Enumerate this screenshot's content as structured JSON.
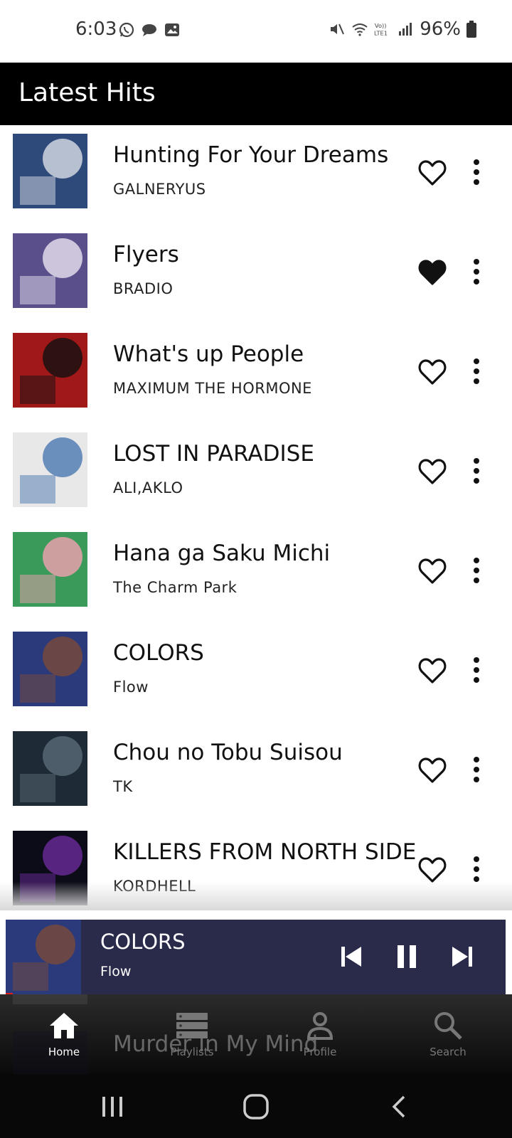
{
  "status_bar": {
    "time": "6:03",
    "left_icons": [
      "whatsapp-icon",
      "chat-bubble-icon",
      "gallery-icon"
    ],
    "right_icons": [
      "mute-icon",
      "wifi-icon",
      "volte-icon",
      "signal-icon"
    ],
    "volte_label": "VoLTE1",
    "battery": "96%"
  },
  "header": {
    "title": "Latest Hits"
  },
  "songs": [
    {
      "title": "Hunting For Your Dreams",
      "artist": "GALNERYUS",
      "liked": false,
      "cover_colors": [
        "#2e4a7a",
        "#d9dde6"
      ]
    },
    {
      "title": "Flyers",
      "artist": "BRADIO",
      "liked": true,
      "cover_colors": [
        "#5a4f8a",
        "#e8e2f0"
      ]
    },
    {
      "title": "What's up People",
      "artist": "MAXIMUM THE HORMONE",
      "liked": false,
      "cover_colors": [
        "#a01818",
        "#111111"
      ]
    },
    {
      "title": "LOST IN PARADISE",
      "artist": "ALI,AKLO",
      "liked": false,
      "cover_colors": [
        "#e8e8e8",
        "#4a78b0"
      ]
    },
    {
      "title": "Hana ga Saku Michi",
      "artist": "The Charm Park",
      "liked": false,
      "cover_colors": [
        "#3a9a5a",
        "#f2a0b0"
      ]
    },
    {
      "title": "COLORS",
      "artist": "Flow",
      "liked": false,
      "cover_colors": [
        "#2a3a7a",
        "#7a4a3a"
      ]
    },
    {
      "title": "Chou no Tobu Suisou",
      "artist": "TK",
      "liked": false,
      "cover_colors": [
        "#1e2a35",
        "#5a6a78"
      ]
    },
    {
      "title": "KILLERS FROM NORTH SIDE",
      "artist": "KORDHELL",
      "liked": false,
      "cover_colors": [
        "#0c0c18",
        "#6a2a9a"
      ]
    }
  ],
  "partially_hidden_song": {
    "title": "Murder In My Mind"
  },
  "mini_player": {
    "title": "COLORS",
    "artist": "Flow",
    "cover_colors": [
      "#2a3a7a",
      "#7a4a3a"
    ],
    "state": "playing"
  },
  "bottom_nav": [
    {
      "label": "Home",
      "icon": "home-icon",
      "active": true
    },
    {
      "label": "Playlists",
      "icon": "playlists-icon",
      "active": false
    },
    {
      "label": "Profile",
      "icon": "profile-icon",
      "active": false
    },
    {
      "label": "Search",
      "icon": "search-icon",
      "active": false
    }
  ],
  "colors": {
    "header_bg": "#000000",
    "mini_player_bg": "#2a2a4a",
    "progress": "#e02020"
  }
}
